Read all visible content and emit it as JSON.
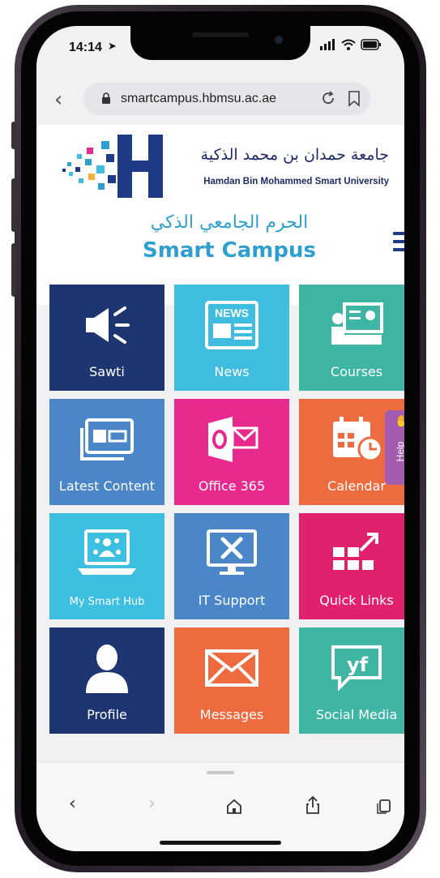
{
  "status_bar": {
    "time": "14:14"
  },
  "browser": {
    "url": "smartcampus.hbmsu.ac.ae"
  },
  "header": {
    "university_name_ar": "جامعة حمدان بن محمد الذكية",
    "university_name_en": "Hamdan Bin Mohammed Smart University",
    "campus_title_ar": "الحرم الجامعي الذكي",
    "campus_title_en": "Smart Campus"
  },
  "tiles": [
    {
      "label": "Sawti",
      "color": "#1d3570",
      "icon": "megaphone-icon"
    },
    {
      "label": "News",
      "color": "#3ebde0",
      "icon": "newspaper-icon"
    },
    {
      "label": "Courses",
      "color": "#3fb5a4",
      "icon": "courses-icon"
    },
    {
      "label": "Latest Content",
      "color": "#4a86c8",
      "icon": "id-card-icon"
    },
    {
      "label": "Office 365",
      "color": "#e8298e",
      "icon": "office-365-icon"
    },
    {
      "label": "Calendar",
      "color": "#ee6a3f",
      "icon": "calendar-clock-icon"
    },
    {
      "label": "My Smart Hub",
      "color": "#3dbfe2",
      "icon": "smart-hub-icon"
    },
    {
      "label": "IT Support",
      "color": "#4a86c8",
      "icon": "tools-icon"
    },
    {
      "label": "Quick Links",
      "color": "#e1216e",
      "icon": "quick-links-icon"
    },
    {
      "label": "Profile",
      "color": "#1d3570",
      "icon": "person-icon"
    },
    {
      "label": "Messages",
      "color": "#ee6a3f",
      "icon": "envelope-icon"
    },
    {
      "label": "Social Media",
      "color": "#3fb5a4",
      "icon": "social-media-icon"
    }
  ],
  "help_tab": {
    "label": "Help"
  },
  "colors": {
    "brand_blue": "#1f2a66",
    "campus_cyan": "#2f9fd0",
    "help_purple": "#a45cb0"
  }
}
